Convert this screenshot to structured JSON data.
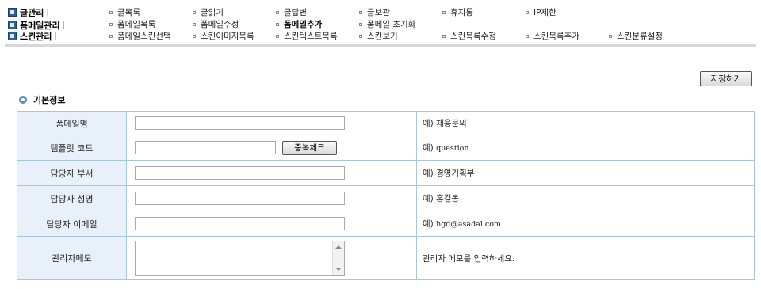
{
  "nav": {
    "categories": [
      {
        "label": "글관리",
        "separator": "|"
      },
      {
        "label": "폼메일관리",
        "separator": "|"
      },
      {
        "label": "스킨관리",
        "separator": "|"
      }
    ],
    "rows": [
      [
        "글목록",
        "글읽기",
        "글답변",
        "글보관",
        "휴지통",
        "IP제한"
      ],
      [
        "폼메일목록",
        "폼메일수정",
        "폼메일추가",
        "폼메일 초기화"
      ],
      [
        "폼메일스킨선택",
        "스킨이미지목록",
        "스킨텍스트목록",
        "스킨보기",
        "스킨목록수정",
        "스킨목록추가",
        "스킨분류설정"
      ]
    ],
    "active": "폼메일추가"
  },
  "save_label": "저장하기",
  "section_title": "기본정보",
  "form": {
    "rows": [
      {
        "label": "폼메일명",
        "value": "",
        "example_prefix": "예)",
        "example": "채용문의"
      },
      {
        "label": "템플릿 코드",
        "value": "",
        "button": "중복체크",
        "example_prefix": "예)",
        "example": "question"
      },
      {
        "label": "담당자 부서",
        "value": "",
        "example_prefix": "예)",
        "example": "경영기획부"
      },
      {
        "label": "담당자 성명",
        "value": "",
        "example_prefix": "예)",
        "example": "홍길동"
      },
      {
        "label": "담당자 이메일",
        "value": "",
        "example_prefix": "예)",
        "example": "hgd@asadal.com"
      },
      {
        "label": "관리자메모",
        "value": "",
        "example": "관리자 메모를 입력하세요."
      }
    ]
  }
}
